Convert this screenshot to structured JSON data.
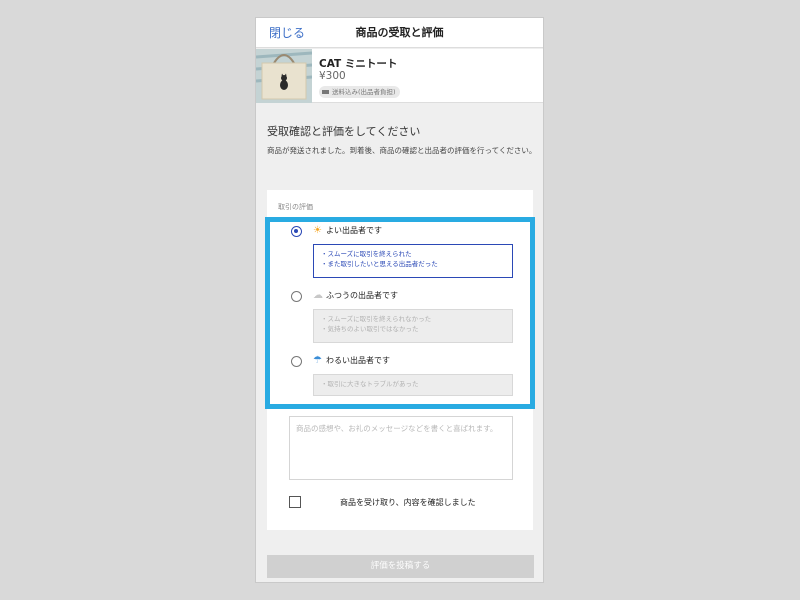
{
  "nav": {
    "close_label": "閉じる",
    "title": "商品の受取と評価"
  },
  "item": {
    "name": "CAT ミニトート",
    "price": "¥300",
    "shipping_badge": "送料込み(出品者負担)"
  },
  "intro": {
    "heading": "受取確認と評価をしてください",
    "description": "商品が発送されました。到着後、商品の確認と出品者の評価を行ってください。"
  },
  "rating": {
    "section_label": "取引の評価",
    "options": [
      {
        "label": "よい出品者です",
        "icon": "sun-icon",
        "selected": true,
        "lines": [
          "・スムーズに取引を終えられた",
          "・また取引したいと思える出品者だった"
        ]
      },
      {
        "label": "ふつうの出品者です",
        "icon": "cloud-icon",
        "selected": false,
        "lines": [
          "・スムーズに取引を終えられなかった",
          "・気持ちのよい取引ではなかった"
        ]
      },
      {
        "label": "わるい出品者です",
        "icon": "umbrella-icon",
        "selected": false,
        "lines": [
          "・取引に大きなトラブルがあった"
        ]
      }
    ]
  },
  "message": {
    "placeholder": "商品の感想や、お礼のメッセージなどを書くと喜ばれます。"
  },
  "confirm": {
    "label": "商品を受け取り、内容を確認しました",
    "checked": false
  },
  "submit": {
    "label": "評価を投稿する",
    "enabled": false
  },
  "colors": {
    "accent": "#2b49b6",
    "link": "#3d6fc7",
    "highlight": "#29abe2",
    "sun": "#f5a623",
    "cloud": "#c8c8c8",
    "umbrella": "#3a8dd6"
  }
}
